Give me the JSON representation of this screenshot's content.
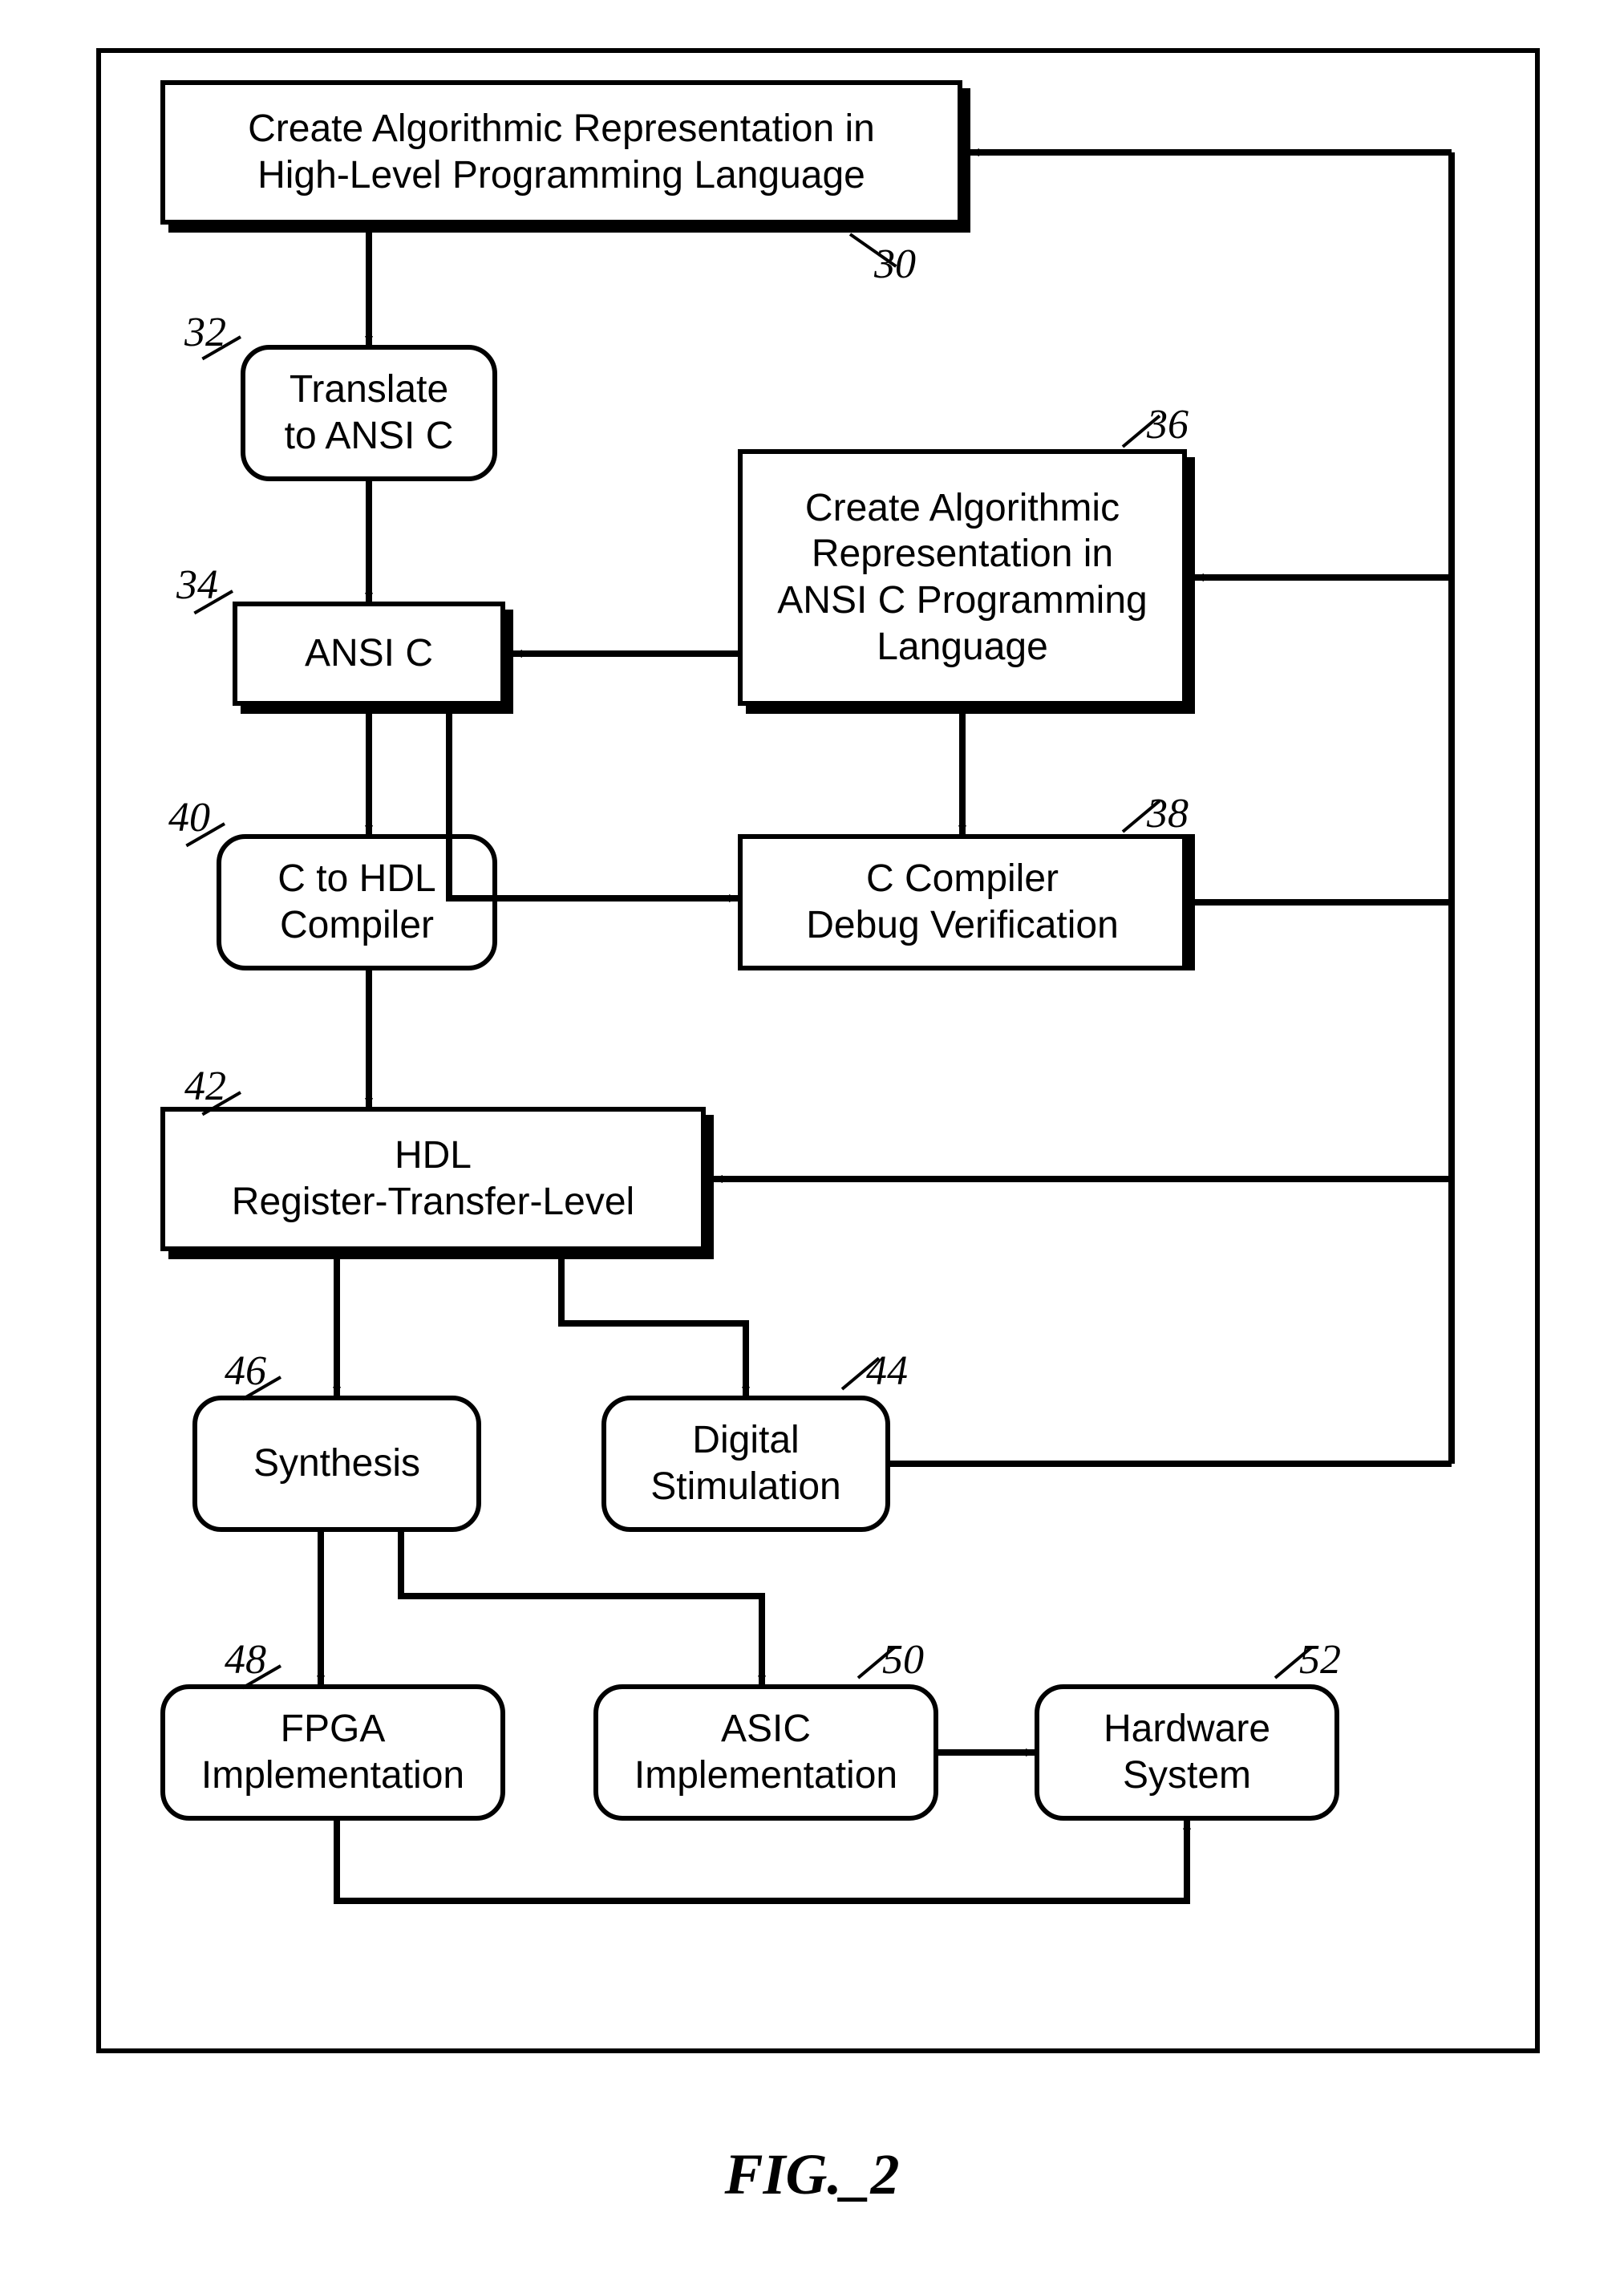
{
  "figure_caption": "FIG._2",
  "nodes": {
    "n30": {
      "ref": "30",
      "text": "Create Algorithmic Representation in\nHigh-Level Programming Language"
    },
    "n32": {
      "ref": "32",
      "text": "Translate\nto ANSI C"
    },
    "n34": {
      "ref": "34",
      "text": "ANSI C"
    },
    "n36": {
      "ref": "36",
      "text": "Create Algorithmic\nRepresentation in\nANSI C Programming\nLanguage"
    },
    "n38": {
      "ref": "38",
      "text": "C Compiler\nDebug Verification"
    },
    "n40": {
      "ref": "40",
      "text": "C to HDL\nCompiler"
    },
    "n42": {
      "ref": "42",
      "text": "HDL\nRegister-Transfer-Level"
    },
    "n44": {
      "ref": "44",
      "text": "Digital\nStimulation"
    },
    "n46": {
      "ref": "46",
      "text": "Synthesis"
    },
    "n48": {
      "ref": "48",
      "text": "FPGA\nImplementation"
    },
    "n50": {
      "ref": "50",
      "text": "ASIC\nImplementation"
    },
    "n52": {
      "ref": "52",
      "text": "Hardware\nSystem"
    }
  },
  "edges_comment": "Directed edges shown as arrows in the figure",
  "edges": [
    [
      "n30",
      "n32"
    ],
    [
      "n32",
      "n34"
    ],
    [
      "n36",
      "n34"
    ],
    [
      "n36",
      "n38"
    ],
    [
      "n34",
      "n38"
    ],
    [
      "n34",
      "n40"
    ],
    [
      "n40",
      "n42"
    ],
    [
      "n42",
      "n46"
    ],
    [
      "n42",
      "n44"
    ],
    [
      "n46",
      "n48"
    ],
    [
      "n46",
      "n50"
    ],
    [
      "n50",
      "n52"
    ],
    [
      "n48",
      "n52"
    ],
    [
      "n38",
      "n30"
    ],
    [
      "n38",
      "n36"
    ],
    [
      "n44",
      "n30"
    ],
    [
      "n44",
      "n42"
    ],
    [
      "n44",
      "n34"
    ]
  ]
}
